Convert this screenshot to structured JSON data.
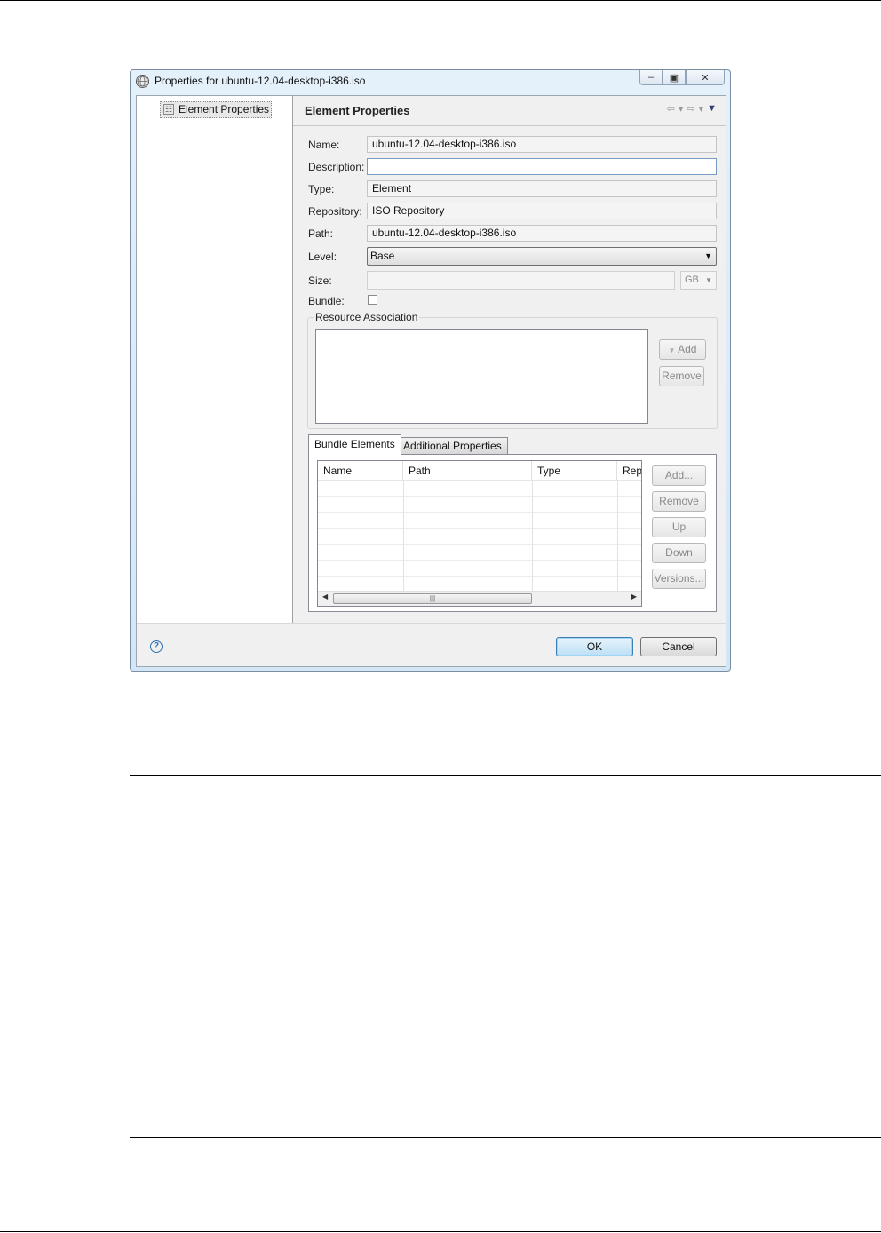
{
  "window": {
    "title": "Properties for ubuntu-12.04-desktop-i386.iso",
    "controls": [
      "minimize",
      "maximize",
      "close"
    ]
  },
  "sidebar": {
    "items": [
      {
        "label": "Element Properties",
        "icon": "element-properties-icon",
        "selected": true
      }
    ]
  },
  "page": {
    "title": "Element Properties",
    "nav_icons": [
      "back-arrow-icon",
      "forward-arrow-icon",
      "view-menu-icon"
    ]
  },
  "form": {
    "name_label": "Name:",
    "name_value": "ubuntu-12.04-desktop-i386.iso",
    "description_label": "Description:",
    "description_value": "",
    "type_label": "Type:",
    "type_value": "Element",
    "repository_label": "Repository:",
    "repository_value": "ISO Repository",
    "path_label": "Path:",
    "path_value": "ubuntu-12.04-desktop-i386.iso",
    "level_label": "Level:",
    "level_value": "Base",
    "size_label": "Size:",
    "size_value": "",
    "size_unit": "GB",
    "bundle_label": "Bundle:",
    "bundle_checked": false
  },
  "resource_association": {
    "label": "Resource Association",
    "add_label": "Add",
    "remove_label": "Remove"
  },
  "tabs": [
    {
      "label": "Bundle Elements",
      "active": true
    },
    {
      "label": "Additional Properties",
      "active": false
    }
  ],
  "bundle_table": {
    "columns": [
      "Name",
      "Path",
      "Type",
      "Rep"
    ],
    "rows": []
  },
  "bundle_buttons": {
    "add": "Add...",
    "remove": "Remove",
    "up": "Up",
    "down": "Down",
    "versions": "Versions..."
  },
  "footer": {
    "ok": "OK",
    "cancel": "Cancel"
  },
  "colors": {
    "dialog_frame": "#d4e6f5",
    "primary_button": "#bcdff5",
    "help_icon": "#2e6fb5"
  }
}
